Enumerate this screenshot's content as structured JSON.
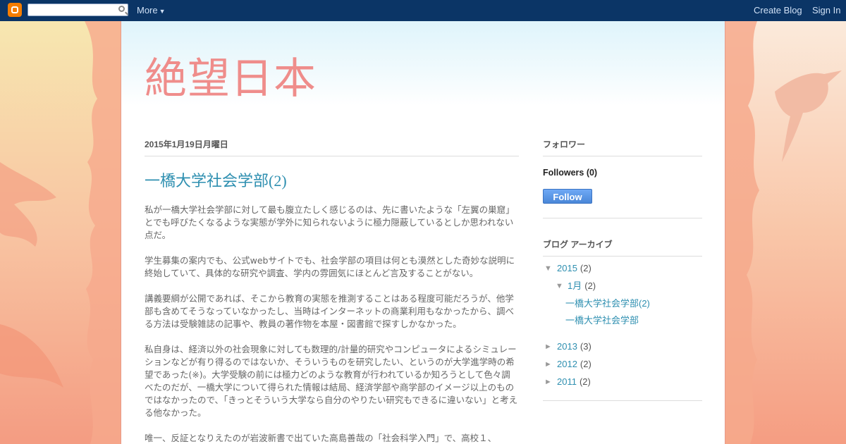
{
  "navbar": {
    "more_label": "More",
    "create_blog_label": "Create Blog",
    "sign_in_label": "Sign In",
    "search_placeholder": ""
  },
  "blog": {
    "title": "絶望日本"
  },
  "post": {
    "date": "2015年1月19日月曜日",
    "title": "一橋大学社会学部(2)",
    "paragraphs": [
      "私が一橋大学社会学部に対して最も腹立たしく感じるのは、先に書いたような「左翼の巣窟」とでも呼びたくなるような実態が学外に知られないように極力隠蔽しているとしか思われない点だ。",
      "学生募集の案内でも、公式webサイトでも、社会学部の項目は何とも漠然とした奇妙な説明に終始していて、具体的な研究や調査、学内の雰囲気にほとんど言及することがない。",
      "講義要綱が公開であれば、そこから教育の実態を推測することはある程度可能だろうが、他学部も含めてそうなっていなかったし、当時はインターネットの商業利用もなかったから、調べる方法は受験雑誌の記事や、教員の著作物を本屋・図書館で探すしかなかった。",
      "私自身は、経済以外の社会現象に対しても数理的/計量的研究やコンピュータによるシミュレーションなどが有り得るのではないか、そういうものを研究したい、というのが大学進学時の希望であった(※)。大学受験の前には極力どのような教育が行われているか知ろうとして色々調べたのだが、一橋大学について得られた情報は結局、経済学部や商学部のイメージ以上のものではなかったので、「きっとそういう大学なら自分のやりたい研究もできるに違いない」と考える他なかった。",
      "唯一、反証となりえたのが岩波新書で出ていた高島善哉の「社会科学入門」で、高校１、"
    ]
  },
  "sidebar": {
    "followers_title": "フォロワー",
    "followers_count_label": "Followers (0)",
    "follow_button": "Follow",
    "archive_title": "ブログ アーカイブ",
    "archive": {
      "y2015": {
        "toggle": "▼",
        "label": "2015",
        "count": "(2)"
      },
      "m201501": {
        "toggle": "▼",
        "label": "1月",
        "count": "(2)"
      },
      "posts": [
        "一橋大学社会学部(2)",
        "一橋大学社会学部"
      ],
      "y2013": {
        "toggle": "►",
        "label": "2013",
        "count": "(3)"
      },
      "y2012": {
        "toggle": "►",
        "label": "2012",
        "count": "(2)"
      },
      "y2011": {
        "toggle": "►",
        "label": "2011",
        "count": "(2)"
      }
    }
  },
  "colors": {
    "navbar_bg": "#0b3566",
    "title_color": "#ef8d8b",
    "link_color": "#2e8fb0",
    "follow_button": "#4a87d8"
  },
  "icons": [
    "blogger-logo-icon",
    "search-icon",
    "chevron-down-icon",
    "hummingbird-decoration",
    "tree-silhouette-decoration"
  ]
}
